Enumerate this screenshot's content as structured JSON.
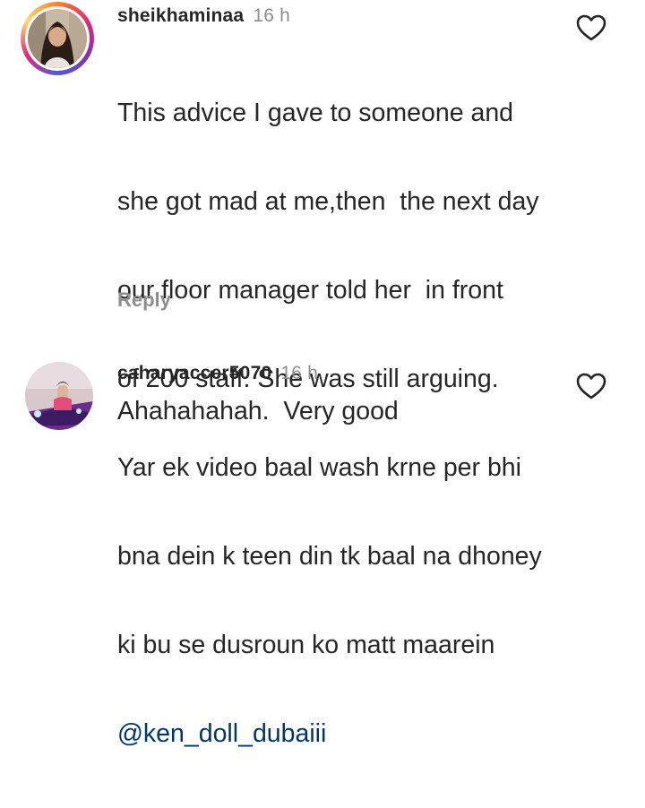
{
  "comments": [
    {
      "username": "sheikhaminaa",
      "time": "16 h",
      "lines": [
        "This advice I gave to someone and",
        "she got mad at me,then  the next day",
        "our floor manager told her  in front",
        "of 200 staff. She was still arguing.",
        "Yar ek video baal wash krne per bhi",
        "bna dein k teen din tk baal na dhoney",
        "ki bu se dusroun ko matt maarein"
      ],
      "mention": "@ken_doll_dubaiii",
      "reply_label": "Reply",
      "like_icon": "heart-outline-icon"
    },
    {
      "username": "caharyaccer5070",
      "time": "16 h",
      "text": "Ahahahahah.  Very good",
      "like_icon": "heart-outline-icon"
    }
  ],
  "colors": {
    "text": "#262626",
    "secondary": "#8e8e8e",
    "mention": "#00376b"
  }
}
